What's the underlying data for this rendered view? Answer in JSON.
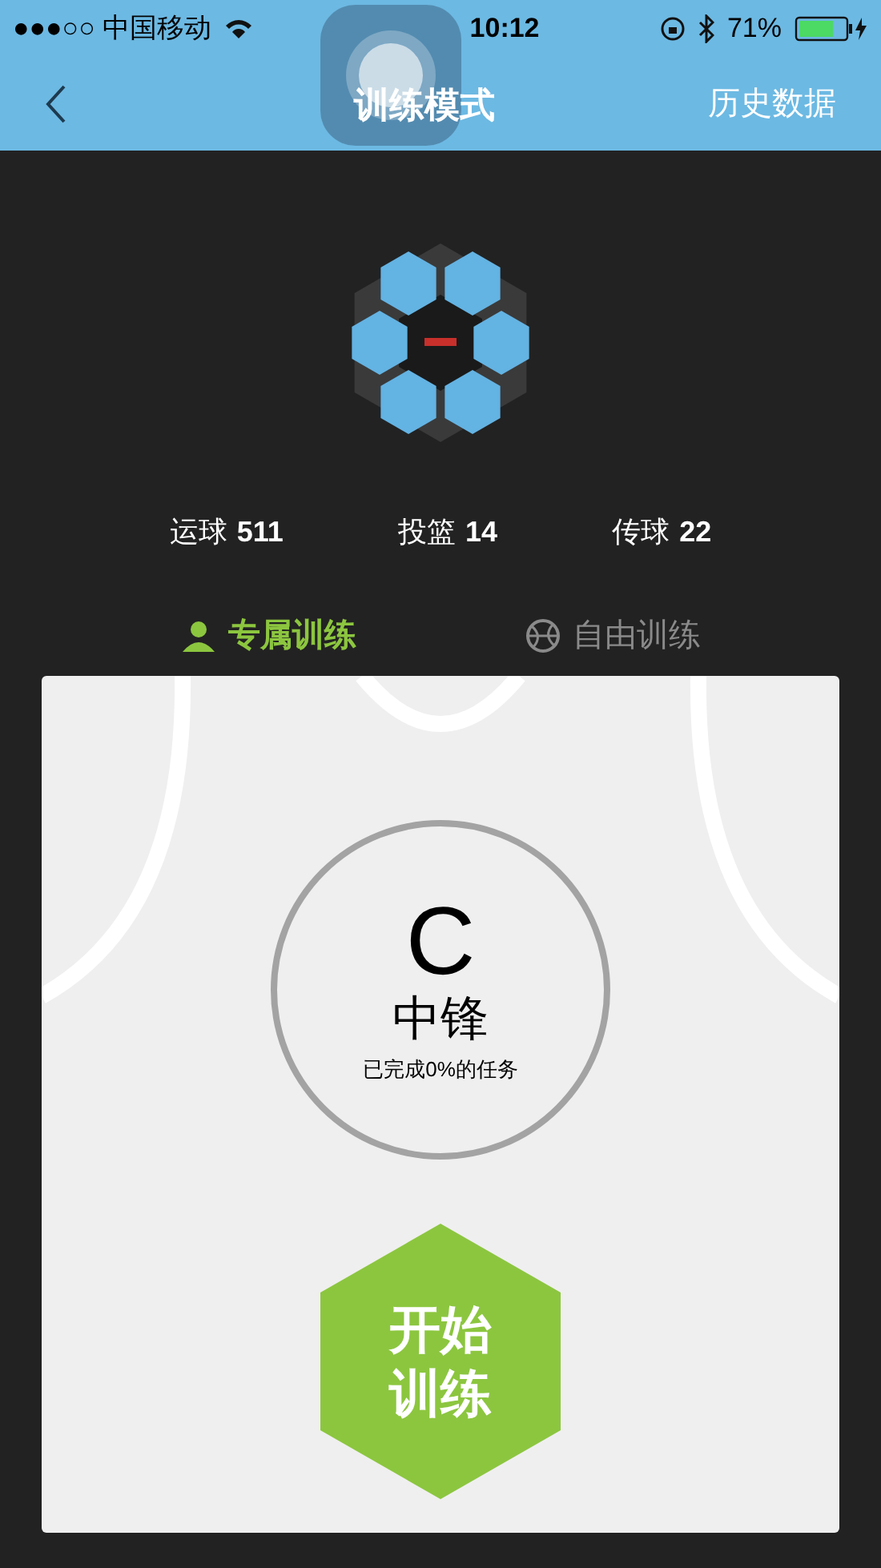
{
  "status_bar": {
    "carrier": "●●●○○ 中国移动",
    "time": "10:12",
    "battery": "71%"
  },
  "nav": {
    "title": "训练模式",
    "action": "历史数据"
  },
  "stats": [
    {
      "label": "运球",
      "value": "511"
    },
    {
      "label": "投篮",
      "value": "14"
    },
    {
      "label": "传球",
      "value": "22"
    }
  ],
  "tabs": [
    {
      "label": "专属训练",
      "selected": true
    },
    {
      "label": "自由训练",
      "selected": false
    }
  ],
  "card": {
    "grade": "C",
    "position": "中锋",
    "progress": "已完成0%的任务",
    "start_button": "开始训练"
  }
}
